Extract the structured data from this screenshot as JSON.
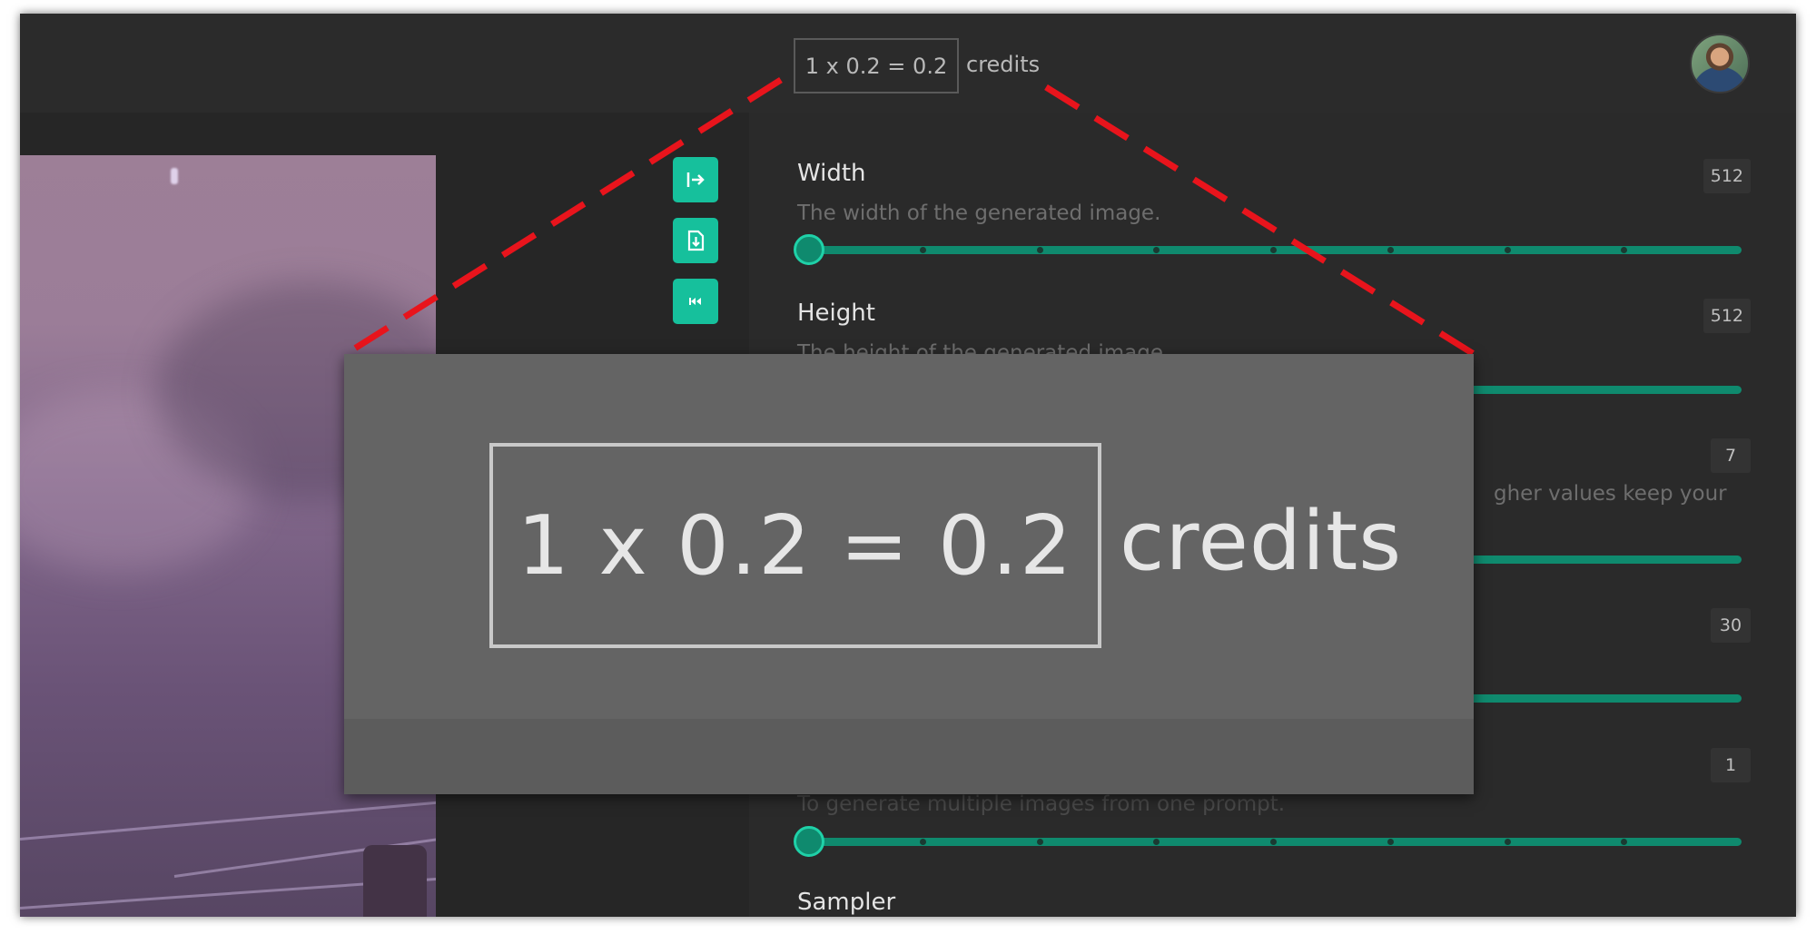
{
  "header": {
    "cost_expression": "1 x 0.2 = 0.2",
    "cost_unit": "credits",
    "avatar": "user-avatar"
  },
  "toolbar": {
    "buttons": [
      {
        "icon": "export-arrow-icon"
      },
      {
        "icon": "download-file-icon"
      },
      {
        "icon": "rewind-icon"
      }
    ]
  },
  "settings": {
    "width": {
      "title": "Width",
      "desc": "The width of the generated image.",
      "value": "512"
    },
    "height": {
      "title": "Height",
      "desc": "The height of the generated image.",
      "value": "512"
    },
    "cfg": {
      "desc_fragment": "gher values keep your",
      "value": "7"
    },
    "steps": {
      "value": "30"
    },
    "count": {
      "desc_fragment": "To generate multiple images from one prompt.",
      "value": "1"
    },
    "sampler": {
      "title": "Sampler"
    }
  },
  "zoom_callout": {
    "cost_expression": "1 x 0.2 = 0.2",
    "cost_unit": "credits"
  },
  "colors": {
    "accent": "#16c09c",
    "slider_track": "#0f8a6e",
    "callout_line": "#e8141c",
    "background": "#262626"
  }
}
